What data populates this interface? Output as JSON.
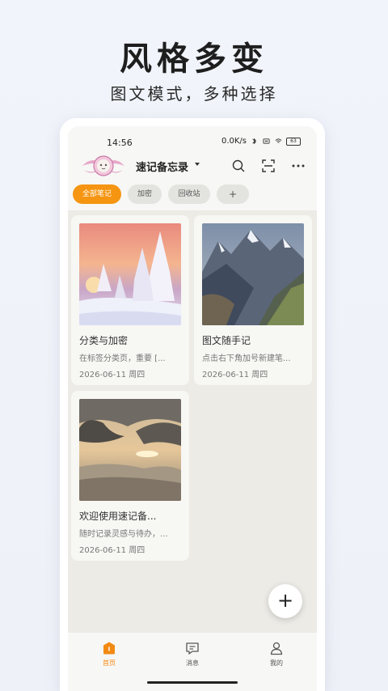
{
  "promo": {
    "headline": "风格多变",
    "subline": "图文模式，多种选择"
  },
  "status": {
    "time": "14:56",
    "net": "0.0K/s",
    "battery": "63"
  },
  "header": {
    "title": "速记备忘录"
  },
  "chips": [
    {
      "label": "全部笔记",
      "active": true
    },
    {
      "label": "加密"
    },
    {
      "label": "回收站"
    },
    {
      "label": "+"
    }
  ],
  "notes": [
    {
      "title": "分类与加密",
      "preview": "在标签分类页，重要 [...",
      "date": "2026-06-11 周四"
    },
    {
      "title": "图文随手记",
      "preview": "点击右下角加号新建笔...",
      "date": "2026-06-11 周四"
    },
    {
      "title": "欢迎使用速记备...",
      "preview": "随时记录灵感与待办，...",
      "date": "2026-06-11 周四"
    }
  ],
  "fab": {
    "label": "+"
  },
  "tabs": [
    {
      "label": "首页",
      "active": true
    },
    {
      "label": "消息"
    },
    {
      "label": "我的"
    }
  ],
  "colors": {
    "accent": "#f59512",
    "background": "#ecebe6"
  }
}
